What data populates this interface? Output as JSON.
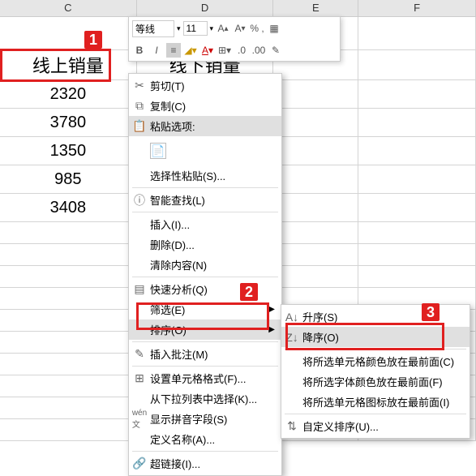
{
  "headers": {
    "C": "C",
    "D": "D",
    "E": "E",
    "F": "F"
  },
  "cell_header_C": "线上销量",
  "cell_header_D": "线下销量",
  "data_C": [
    "2320",
    "3780",
    "1350",
    "985",
    "3408"
  ],
  "toolbar": {
    "font": "等线",
    "size": "11",
    "percent": "% ,"
  },
  "context": {
    "cut": "剪切(T)",
    "copy": "复制(C)",
    "paste_options": "粘贴选项:",
    "paste_special": "选择性粘贴(S)...",
    "smart_lookup": "智能查找(L)",
    "insert": "插入(I)...",
    "delete": "删除(D)...",
    "clear": "清除内容(N)",
    "quick_analysis": "快速分析(Q)",
    "filter": "筛选(E)",
    "sort": "排序(O)",
    "insert_comment": "插入批注(M)",
    "format_cells": "设置单元格格式(F)...",
    "pick_from_list": "从下拉列表中选择(K)...",
    "show_pinyin": "显示拼音字段(S)",
    "define_name": "定义名称(A)...",
    "hyperlink": "超链接(I)..."
  },
  "submenu": {
    "asc": "升序(S)",
    "desc": "降序(O)",
    "cell_color": "将所选单元格颜色放在最前面(C)",
    "font_color": "将所选字体颜色放在最前面(F)",
    "cell_icon": "将所选单元格图标放在最前面(I)",
    "custom": "自定义排序(U)..."
  },
  "badges": {
    "b1": "1",
    "b2": "2",
    "b3": "3"
  }
}
